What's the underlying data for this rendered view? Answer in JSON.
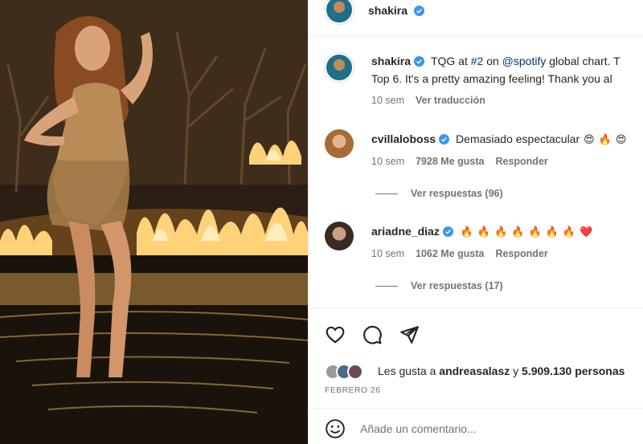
{
  "post": {
    "author": "shakira",
    "caption_author": "shakira",
    "caption_prefix": "TQG at ",
    "caption_hashtag": "#2",
    "caption_mid": " on ",
    "caption_mention": "@spotify",
    "caption_rest": " global chart. T",
    "caption_line2": "Top 6. It's a pretty amazing feeling! Thank you al",
    "caption_time": "10 sem",
    "caption_translate": "Ver traducción"
  },
  "comments": [
    {
      "user": "cvillaloboss",
      "text": "Demasiado espectacular",
      "emojis": [
        "😍",
        "🔥",
        "😍"
      ],
      "time": "10 sem",
      "likes": "7928 Me gusta",
      "reply": "Responder",
      "view_replies": "Ver respuestas (96)"
    },
    {
      "user": "ariadne_diaz",
      "text": "",
      "emojis": [
        "🔥",
        "🔥",
        "🔥",
        "🔥",
        "🔥",
        "🔥",
        "🔥",
        "❤️"
      ],
      "time": "10 sem",
      "likes": "1062 Me gusta",
      "reply": "Responder",
      "view_replies": "Ver respuestas (17)"
    }
  ],
  "likes_bar": {
    "prefix": "Les gusta a ",
    "user": "andreasalasz",
    "mid": " y ",
    "count": "5.909.130 personas"
  },
  "date": "FEBRERO 26",
  "add_comment": {
    "placeholder": "Añade un comentario..."
  },
  "icons": {
    "like": "heart-icon",
    "comment": "comment-bubble-icon",
    "share": "paper-plane-icon",
    "emoji": "smiley-icon",
    "verified": "verified-badge-icon"
  },
  "colors": {
    "verified": "#3897f0",
    "link": "#00376b",
    "muted": "#737373"
  }
}
